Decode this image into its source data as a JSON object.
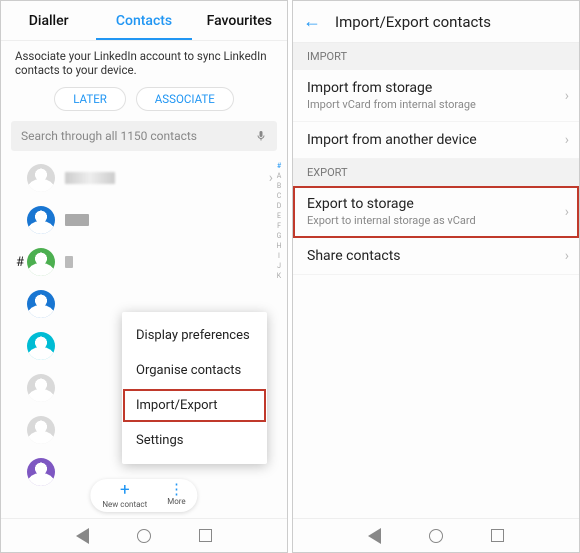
{
  "left": {
    "tabs": {
      "dialler": "Dialler",
      "contacts": "Contacts",
      "favourites": "Favourites"
    },
    "linkedin_msg": "Associate your LinkedIn account to sync LinkedIn contacts to your device.",
    "later": "LATER",
    "associate": "ASSOCIATE",
    "search_placeholder": "Search through all 1150 contacts",
    "section_mark": "#",
    "index": [
      "#",
      "A",
      "B",
      "C",
      "D",
      "E",
      "F",
      "G",
      "H",
      "I",
      "J",
      "K"
    ],
    "fab": {
      "new": "New contact",
      "more": "More"
    },
    "menu": {
      "display": "Display preferences",
      "organise": "Organise contacts",
      "importexport": "Import/Export",
      "settings": "Settings"
    }
  },
  "right": {
    "title": "Import/Export contacts",
    "groups": {
      "import": "IMPORT",
      "export": "EXPORT"
    },
    "opt1": {
      "t": "Import from storage",
      "s": "Import vCard from internal storage"
    },
    "opt2": {
      "t": "Import from another device"
    },
    "opt3": {
      "t": "Export to storage",
      "s": "Export to internal storage as vCard"
    },
    "opt4": {
      "t": "Share contacts"
    }
  }
}
